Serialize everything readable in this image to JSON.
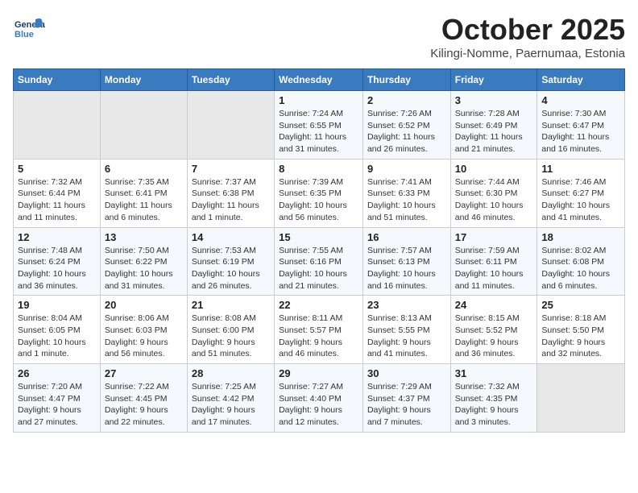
{
  "header": {
    "logo_line1": "General",
    "logo_line2": "Blue",
    "month": "October 2025",
    "location": "Kilingi-Nomme, Paernumaa, Estonia"
  },
  "weekdays": [
    "Sunday",
    "Monday",
    "Tuesday",
    "Wednesday",
    "Thursday",
    "Friday",
    "Saturday"
  ],
  "weeks": [
    [
      {
        "day": "",
        "info": ""
      },
      {
        "day": "",
        "info": ""
      },
      {
        "day": "",
        "info": ""
      },
      {
        "day": "1",
        "info": "Sunrise: 7:24 AM\nSunset: 6:55 PM\nDaylight: 11 hours and 31 minutes."
      },
      {
        "day": "2",
        "info": "Sunrise: 7:26 AM\nSunset: 6:52 PM\nDaylight: 11 hours and 26 minutes."
      },
      {
        "day": "3",
        "info": "Sunrise: 7:28 AM\nSunset: 6:49 PM\nDaylight: 11 hours and 21 minutes."
      },
      {
        "day": "4",
        "info": "Sunrise: 7:30 AM\nSunset: 6:47 PM\nDaylight: 11 hours and 16 minutes."
      }
    ],
    [
      {
        "day": "5",
        "info": "Sunrise: 7:32 AM\nSunset: 6:44 PM\nDaylight: 11 hours and 11 minutes."
      },
      {
        "day": "6",
        "info": "Sunrise: 7:35 AM\nSunset: 6:41 PM\nDaylight: 11 hours and 6 minutes."
      },
      {
        "day": "7",
        "info": "Sunrise: 7:37 AM\nSunset: 6:38 PM\nDaylight: 11 hours and 1 minute."
      },
      {
        "day": "8",
        "info": "Sunrise: 7:39 AM\nSunset: 6:35 PM\nDaylight: 10 hours and 56 minutes."
      },
      {
        "day": "9",
        "info": "Sunrise: 7:41 AM\nSunset: 6:33 PM\nDaylight: 10 hours and 51 minutes."
      },
      {
        "day": "10",
        "info": "Sunrise: 7:44 AM\nSunset: 6:30 PM\nDaylight: 10 hours and 46 minutes."
      },
      {
        "day": "11",
        "info": "Sunrise: 7:46 AM\nSunset: 6:27 PM\nDaylight: 10 hours and 41 minutes."
      }
    ],
    [
      {
        "day": "12",
        "info": "Sunrise: 7:48 AM\nSunset: 6:24 PM\nDaylight: 10 hours and 36 minutes."
      },
      {
        "day": "13",
        "info": "Sunrise: 7:50 AM\nSunset: 6:22 PM\nDaylight: 10 hours and 31 minutes."
      },
      {
        "day": "14",
        "info": "Sunrise: 7:53 AM\nSunset: 6:19 PM\nDaylight: 10 hours and 26 minutes."
      },
      {
        "day": "15",
        "info": "Sunrise: 7:55 AM\nSunset: 6:16 PM\nDaylight: 10 hours and 21 minutes."
      },
      {
        "day": "16",
        "info": "Sunrise: 7:57 AM\nSunset: 6:13 PM\nDaylight: 10 hours and 16 minutes."
      },
      {
        "day": "17",
        "info": "Sunrise: 7:59 AM\nSunset: 6:11 PM\nDaylight: 10 hours and 11 minutes."
      },
      {
        "day": "18",
        "info": "Sunrise: 8:02 AM\nSunset: 6:08 PM\nDaylight: 10 hours and 6 minutes."
      }
    ],
    [
      {
        "day": "19",
        "info": "Sunrise: 8:04 AM\nSunset: 6:05 PM\nDaylight: 10 hours and 1 minute."
      },
      {
        "day": "20",
        "info": "Sunrise: 8:06 AM\nSunset: 6:03 PM\nDaylight: 9 hours and 56 minutes."
      },
      {
        "day": "21",
        "info": "Sunrise: 8:08 AM\nSunset: 6:00 PM\nDaylight: 9 hours and 51 minutes."
      },
      {
        "day": "22",
        "info": "Sunrise: 8:11 AM\nSunset: 5:57 PM\nDaylight: 9 hours and 46 minutes."
      },
      {
        "day": "23",
        "info": "Sunrise: 8:13 AM\nSunset: 5:55 PM\nDaylight: 9 hours and 41 minutes."
      },
      {
        "day": "24",
        "info": "Sunrise: 8:15 AM\nSunset: 5:52 PM\nDaylight: 9 hours and 36 minutes."
      },
      {
        "day": "25",
        "info": "Sunrise: 8:18 AM\nSunset: 5:50 PM\nDaylight: 9 hours and 32 minutes."
      }
    ],
    [
      {
        "day": "26",
        "info": "Sunrise: 7:20 AM\nSunset: 4:47 PM\nDaylight: 9 hours and 27 minutes."
      },
      {
        "day": "27",
        "info": "Sunrise: 7:22 AM\nSunset: 4:45 PM\nDaylight: 9 hours and 22 minutes."
      },
      {
        "day": "28",
        "info": "Sunrise: 7:25 AM\nSunset: 4:42 PM\nDaylight: 9 hours and 17 minutes."
      },
      {
        "day": "29",
        "info": "Sunrise: 7:27 AM\nSunset: 4:40 PM\nDaylight: 9 hours and 12 minutes."
      },
      {
        "day": "30",
        "info": "Sunrise: 7:29 AM\nSunset: 4:37 PM\nDaylight: 9 hours and 7 minutes."
      },
      {
        "day": "31",
        "info": "Sunrise: 7:32 AM\nSunset: 4:35 PM\nDaylight: 9 hours and 3 minutes."
      },
      {
        "day": "",
        "info": ""
      }
    ]
  ]
}
